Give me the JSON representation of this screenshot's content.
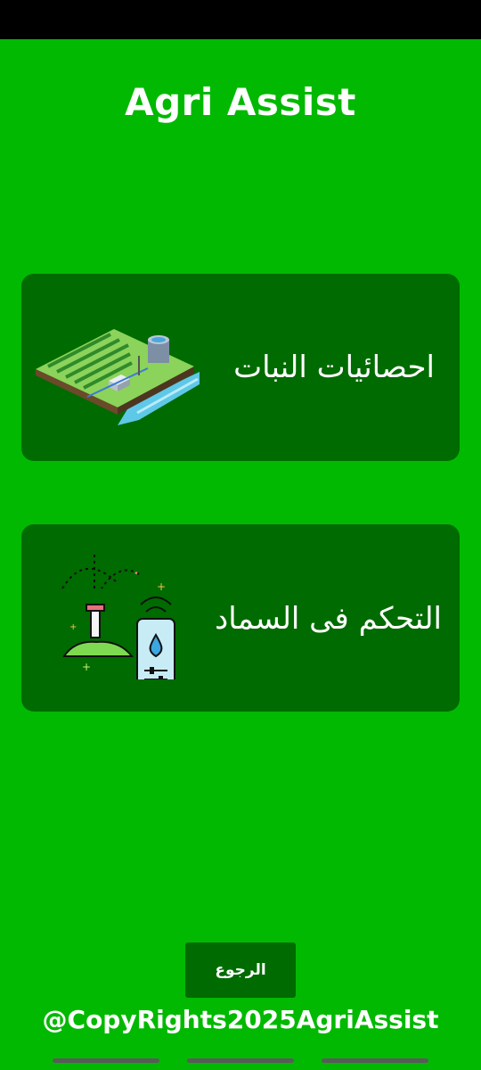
{
  "app": {
    "title": "Agri Assist"
  },
  "cards": [
    {
      "label": "احصائيات النبات",
      "icon": "farm-field-icon"
    },
    {
      "label": "التحكم فى السماد",
      "icon": "smart-irrigation-icon"
    }
  ],
  "back_button": {
    "label": "الرجوع"
  },
  "footer": {
    "copyright": "@CopyRights2025AgriAssist"
  },
  "colors": {
    "background": "#02b902",
    "card": "#006b00",
    "text": "#ffffff"
  }
}
